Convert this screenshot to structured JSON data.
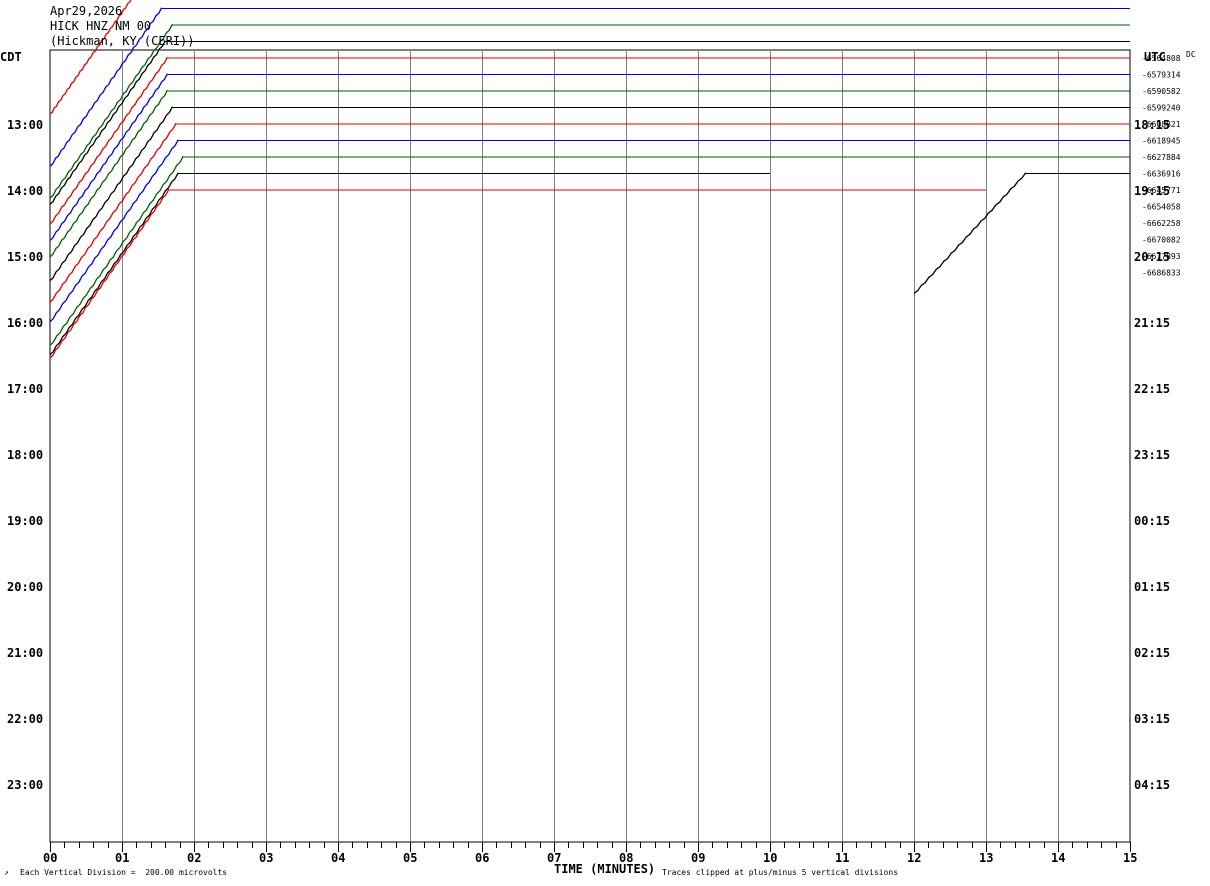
{
  "header": {
    "date": "Apr29,2026",
    "station": "HICK HNZ NM 00",
    "location": "(Hickman, KY (CERI))"
  },
  "left_tz": "CDT",
  "right_tz": "UTC",
  "dc_label": "DC",
  "footer": {
    "scale": "Each Vertical Division =  200.00 microvolts",
    "xlabel": "TIME (MINUTES)",
    "clip": "Traces clipped at plus/minus 5 vertical divisions"
  },
  "chart_data": {
    "type": "line",
    "title": "HICK HNZ NM 00",
    "xlabel": "TIME (MINUTES)",
    "xlim": [
      0,
      15
    ],
    "x_ticks": [
      "00",
      "01",
      "02",
      "03",
      "04",
      "05",
      "06",
      "07",
      "08",
      "09",
      "10",
      "11",
      "12",
      "13",
      "14",
      "15"
    ],
    "left_time_labels": [
      "13:00",
      "14:00",
      "15:00",
      "16:00",
      "17:00",
      "18:00",
      "19:00",
      "20:00",
      "21:00",
      "22:00",
      "23:00"
    ],
    "right_time_labels": [
      "18:15",
      "19:15",
      "20:15",
      "21:15",
      "22:15",
      "23:15",
      "00:15",
      "01:15",
      "02:15",
      "03:15",
      "04:15"
    ],
    "trace_dc_offsets": [
      "-6564808",
      "-6579314",
      "-6590582",
      "-6599240",
      "-6608821",
      "-6618945",
      "-6627884",
      "-6636916",
      "-6645771",
      "-6654058",
      "-6662258",
      "-6670082",
      "-6677893",
      "-6686833"
    ],
    "trace_colors": [
      "#000000",
      "#e00000",
      "#0000e0",
      "#006000"
    ],
    "traces": [
      {
        "row": -4,
        "color": "#e00000",
        "ramp_end_min": 1.2,
        "flat_end_min": 15
      },
      {
        "row": -3,
        "color": "#0000e0",
        "ramp_end_min": 1.55,
        "flat_end_min": 15
      },
      {
        "row": -2,
        "color": "#006000",
        "ramp_end_min": 1.7,
        "flat_end_min": 15
      },
      {
        "row": -1,
        "color": "#000000",
        "ramp_end_min": 1.6,
        "flat_end_min": 15
      },
      {
        "row": 0,
        "color": "#e00000",
        "ramp_end_min": 1.63,
        "flat_end_min": 15
      },
      {
        "row": 1,
        "color": "#0000e0",
        "ramp_end_min": 1.63,
        "flat_end_min": 15
      },
      {
        "row": 2,
        "color": "#006000",
        "ramp_end_min": 1.63,
        "flat_end_min": 15
      },
      {
        "row": 3,
        "color": "#000000",
        "ramp_end_min": 1.7,
        "flat_end_min": 15
      },
      {
        "row": 4,
        "color": "#e00000",
        "ramp_end_min": 1.75,
        "flat_end_min": 15
      },
      {
        "row": 5,
        "color": "#0000e0",
        "ramp_end_min": 1.78,
        "flat_end_min": 15
      },
      {
        "row": 6,
        "color": "#006000",
        "ramp_end_min": 1.85,
        "flat_end_min": 15
      },
      {
        "row": 7,
        "color": "#000000",
        "ramp_end_min": 1.78,
        "flat_end_min": 10
      },
      {
        "row": 8,
        "color": "#e00000",
        "ramp_end_min": 1.65,
        "flat_end_min": 13
      }
    ],
    "late_segment": {
      "color": "#000000",
      "row": 7,
      "start_min": 12.0,
      "ramp_end_min": 13.55,
      "flat_end_min": 15
    },
    "grid": true
  }
}
